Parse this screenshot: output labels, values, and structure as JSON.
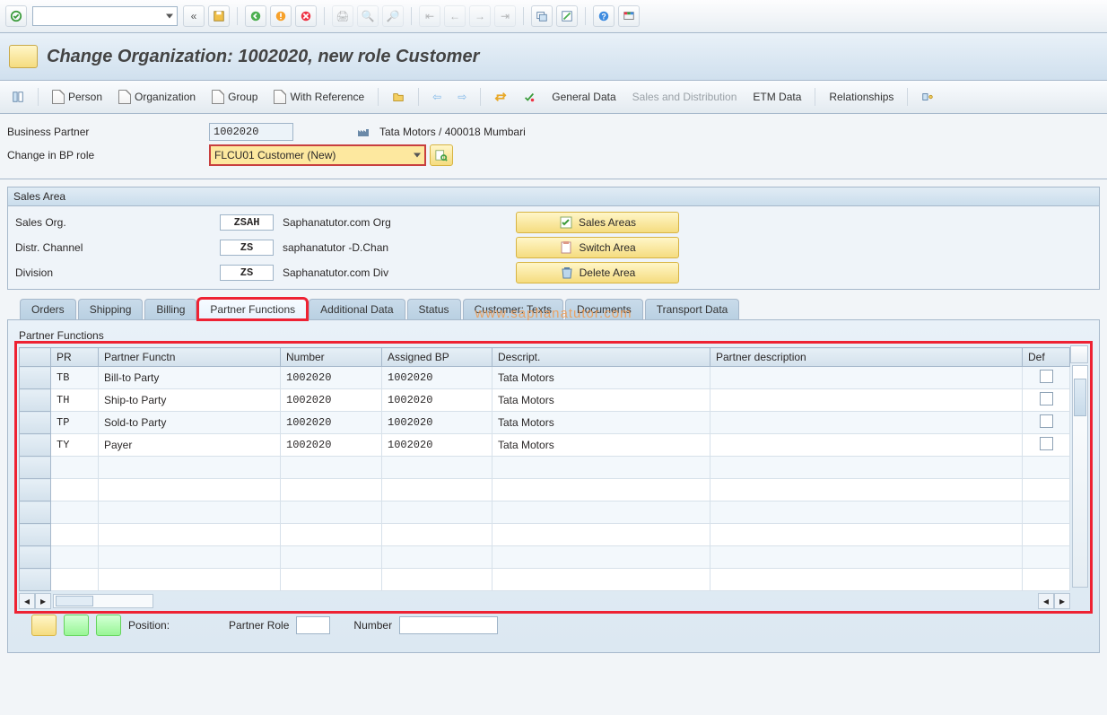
{
  "page_title": "Change Organization: 1002020, new role Customer",
  "watermark": "www.saphanatutor.com",
  "system_toolbar_icons": [
    "ok",
    "back",
    "save",
    "exit",
    "cancel",
    "end",
    "print",
    "find",
    "find-next",
    "first",
    "prev",
    "next",
    "last",
    "new-session",
    "layout",
    "help",
    "customize"
  ],
  "app_toolbar": {
    "person": "Person",
    "organization": "Organization",
    "group": "Group",
    "with_reference": "With Reference",
    "general_data": "General Data",
    "sales_dist": "Sales and Distribution",
    "etm_data": "ETM Data",
    "relationships": "Relationships"
  },
  "header": {
    "bp_label": "Business Partner",
    "bp_value": "1002020",
    "bp_desc": "Tata Motors / 400018 Mumbari",
    "role_label": "Change in BP role",
    "role_value": "FLCU01 Customer (New)"
  },
  "sales_area": {
    "title": "Sales Area",
    "sales_org_lbl": "Sales Org.",
    "sales_org_code": "ZSAH",
    "sales_org_txt": "Saphanatutor.com Org",
    "dist_ch_lbl": "Distr. Channel",
    "dist_ch_code": "ZS",
    "dist_ch_txt": "saphanatutor -D.Chan",
    "division_lbl": "Division",
    "division_code": "ZS",
    "division_txt": "Saphanatutor.com Div",
    "btn_sales_areas": "Sales Areas",
    "btn_switch": "Switch Area",
    "btn_delete": "Delete Area"
  },
  "tabs": {
    "orders": "Orders",
    "shipping": "Shipping",
    "billing": "Billing",
    "partner_functions": "Partner Functions",
    "additional_data": "Additional Data",
    "status": "Status",
    "customer_texts": "Customer: Texts",
    "documents": "Documents",
    "transport_data": "Transport Data"
  },
  "partner_table": {
    "title": "Partner Functions",
    "columns": {
      "pr": "PR",
      "pf": "Partner Functn",
      "num": "Number",
      "abp": "Assigned BP",
      "desc": "Descript.",
      "pdesc": "Partner description",
      "def": "Def"
    },
    "rows": [
      {
        "pr": "TB",
        "pf": "Bill-to Party",
        "num": "1002020",
        "abp": "1002020",
        "desc": "Tata Motors",
        "pdesc": "",
        "def": false
      },
      {
        "pr": "TH",
        "pf": "Ship-to Party",
        "num": "1002020",
        "abp": "1002020",
        "desc": "Tata Motors",
        "pdesc": "",
        "def": false
      },
      {
        "pr": "TP",
        "pf": "Sold-to Party",
        "num": "1002020",
        "abp": "1002020",
        "desc": "Tata Motors",
        "pdesc": "",
        "def": false
      },
      {
        "pr": "TY",
        "pf": "Payer",
        "num": "1002020",
        "abp": "1002020",
        "desc": "Tata Motors",
        "pdesc": "",
        "def": false
      }
    ]
  },
  "footer": {
    "position_lbl": "Position:",
    "partner_role_lbl": "Partner Role",
    "number_lbl": "Number"
  }
}
